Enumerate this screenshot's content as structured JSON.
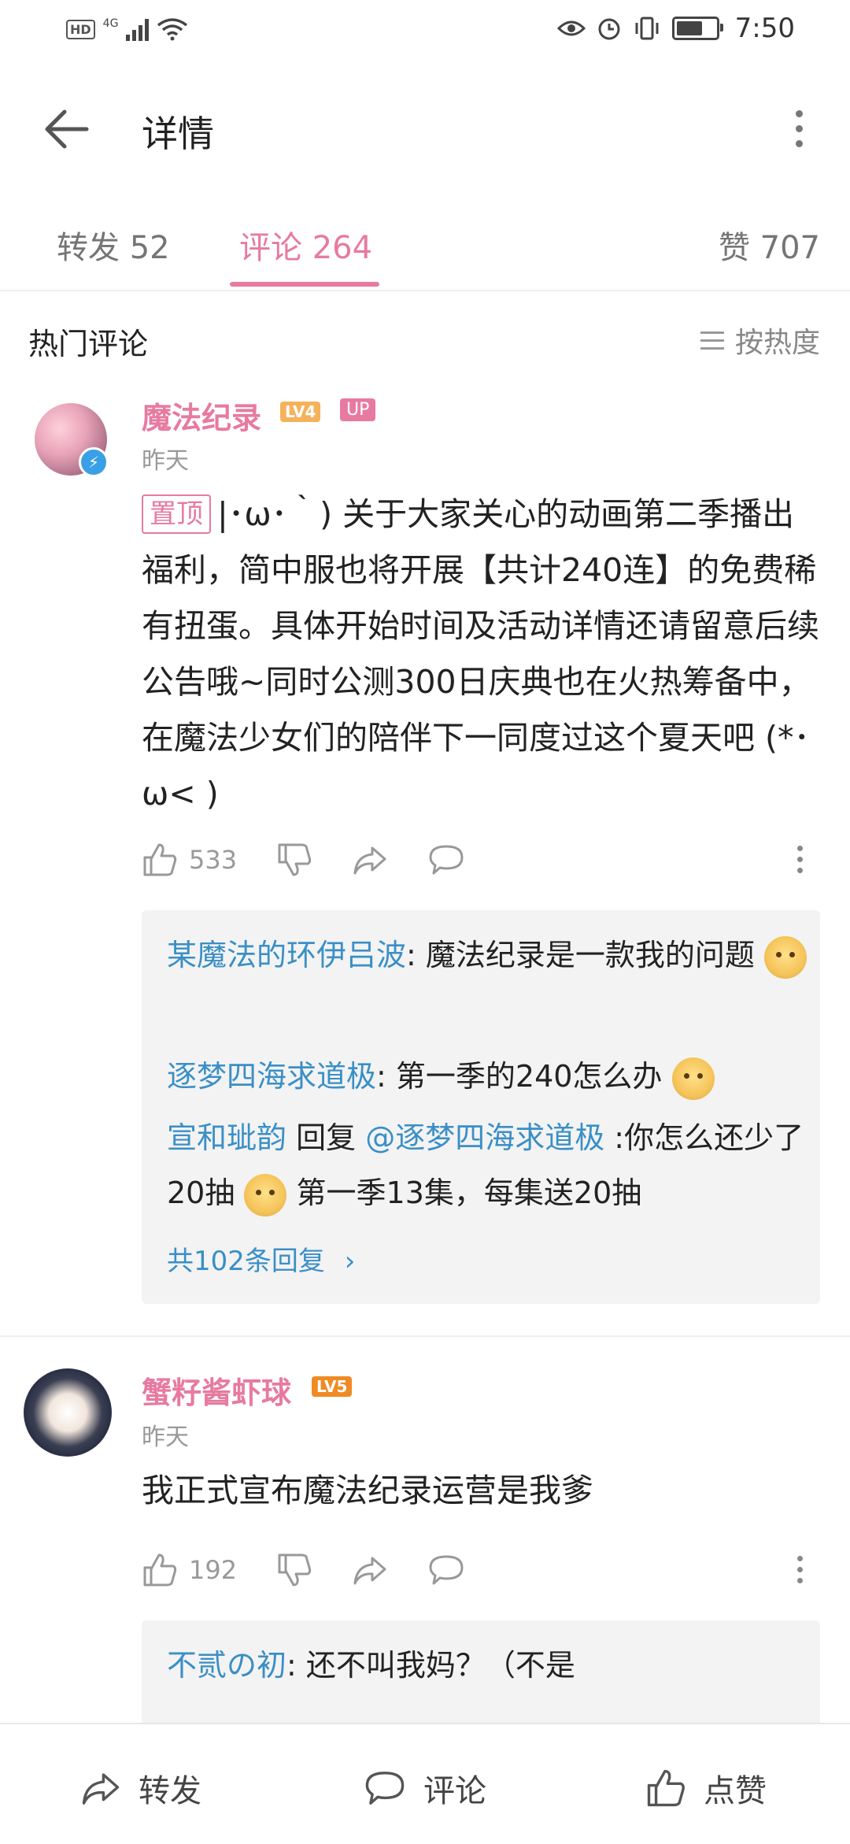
{
  "status_bar": {
    "network": "4G",
    "hd": "HD",
    "time": "7:50",
    "icons": [
      "eye-icon",
      "alarm-icon",
      "vibrate-icon",
      "battery-icon"
    ]
  },
  "header": {
    "title": "详情",
    "back_icon": "back-arrow-icon",
    "more_icon": "more-vert-icon"
  },
  "tabs": [
    {
      "label": "转发 52"
    },
    {
      "label": "评论 264",
      "active": true
    },
    {
      "label": "赞 707"
    }
  ],
  "section": {
    "title": "热门评论",
    "sort_label": "按热度"
  },
  "comments": [
    {
      "user": "魔法纪录",
      "level": "LV4",
      "badge": "UP",
      "time": "昨天",
      "pinned_label": "置顶",
      "text": "|･ω･｀) 关于大家关心的动画第二季播出福利，简中服也将开展【共计240连】的免费稀有扭蛋。具体开始时间及活动详情还请留意后续公告哦~同时公测300日庆典也在火热筹备中，在魔法少女们的陪伴下一同度过这个夏天吧 (*･ω< )",
      "likes": "533",
      "replies": [
        {
          "name": "某魔法的环伊吕波",
          "sep": ": ",
          "text": "魔法纪录是一款我的问题"
        },
        {
          "name": "逐梦四海求道极",
          "sep": ": ",
          "text": "第一季的240怎么办"
        },
        {
          "name": "宣和玼韵",
          "mid": " 回复 ",
          "target": "@逐梦四海求道极",
          "sep": " :",
          "text": "你怎么还少了20抽",
          "text2": " 第一季13集，每集送20抽"
        }
      ],
      "more_replies": "共102条回复"
    },
    {
      "user": "蟹籽酱虾球",
      "level": "LV5",
      "time": "昨天",
      "text": "我正式宣布魔法纪录运营是我爹",
      "likes": "192",
      "replies": [
        {
          "name": "不贰の初",
          "sep": ": ",
          "text": "还不叫我妈？（不是"
        }
      ]
    }
  ],
  "bottom_bar": {
    "share": "转发",
    "comment": "评论",
    "like": "点赞"
  },
  "colors": {
    "accent": "#e77aa0",
    "link": "#3a8fc6",
    "level4": "#f5b25b",
    "level5": "#f08a24"
  }
}
